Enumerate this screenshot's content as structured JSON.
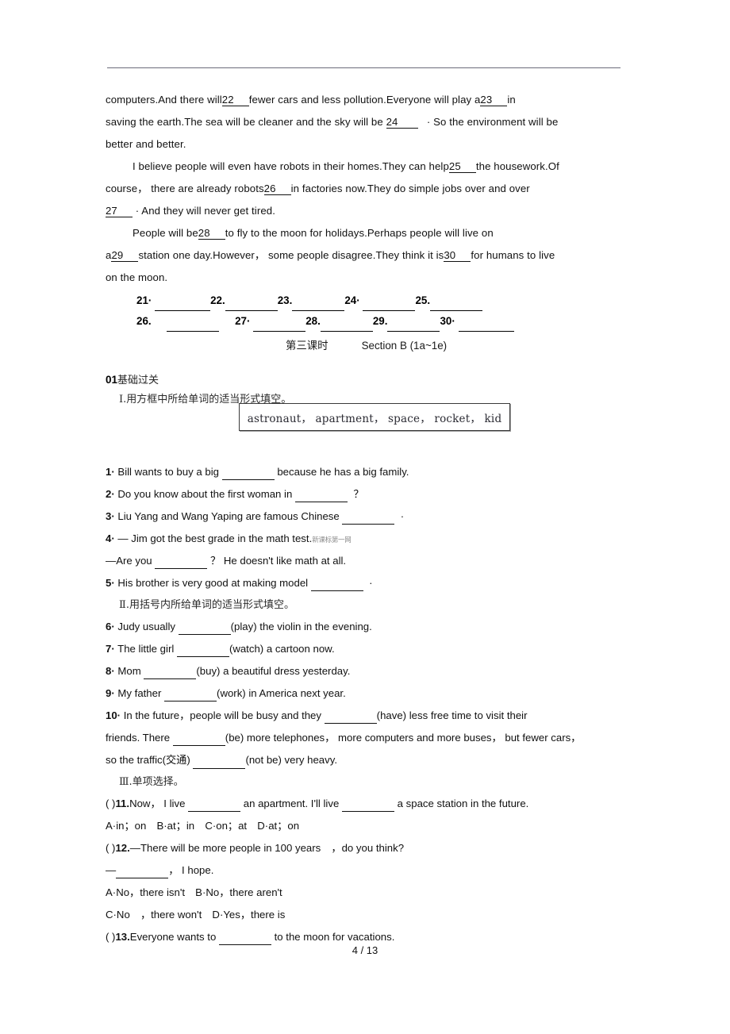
{
  "document": {
    "page_number_label": "4 / 13"
  },
  "passage": {
    "para1": {
      "seg1": "computers.And  there  will",
      "blank22": "22",
      "seg2": "fewer   cars  and  less  pollution.Everyone   will   play   a",
      "blank23": "23",
      "seg3": "in",
      "seg4": "saving the earth.The sea will be cleaner and the sky will be",
      "blank24": "24",
      "seg5": "· So the environment will be",
      "seg6": "better and better."
    },
    "para2": {
      "seg1": "I believe people will even have robots in their homes.They can help",
      "blank25": "25",
      "seg2": "the housework.Of",
      "seg3": "course，  there  are  already  robots",
      "blank26": "26",
      "seg4": "in  factories  now.They  do  simple  jobs  over  and  over",
      "blank27": "27",
      "seg5": "· And they will never get tired."
    },
    "para3": {
      "seg1": "People  will   be",
      "blank28": "28",
      "seg2": "to  fly  to  the  moon  for  holidays.Perhaps  people  will   live  on",
      "seg3": "a",
      "blank29": "29",
      "seg4": "station one day.However， some people disagree.They think it is",
      "blank30": "30",
      "seg5": "for humans to live",
      "seg6": "on the moon."
    }
  },
  "answer_rows": [
    {
      "items": [
        {
          "num": "21·"
        },
        {
          "num": "22."
        },
        {
          "num": "23."
        },
        {
          "num": "24·"
        },
        {
          "num": "25."
        }
      ]
    },
    {
      "items": [
        {
          "num": "26."
        },
        {
          "num": "27·"
        },
        {
          "num": "28."
        },
        {
          "num": "29."
        },
        {
          "num": "30·"
        }
      ]
    }
  ],
  "lesson_title": {
    "period": "第三课时",
    "section": "Section B (1a~1e)"
  },
  "section_01": {
    "number": "01",
    "label": "基础过关"
  },
  "part1": {
    "heading_numeral": "Ⅰ",
    "heading_text": ".用方框中所给单词的适当形式填空。",
    "word_box": "astronaut， apartment， space， rocket， kid",
    "questions": [
      {
        "num": "1·",
        "before": "Bill wants to buy a big",
        "after": "because he has a big family."
      },
      {
        "num": "2·",
        "before": "Do you know about the first woman in",
        "after": "？"
      },
      {
        "num": "3·",
        "before": "Liu Yang and Wang Yaping are famous Chinese",
        "after": "·"
      },
      {
        "num": "4·",
        "before": "— Jim got the best grade in the math test.",
        "watermark": "新课标第一网",
        "line2_before": "—Are you",
        "line2_after": "？ He doesn't like math at all."
      },
      {
        "num": "5·",
        "before": "His brother is very good at making model",
        "after": "·"
      }
    ]
  },
  "part2": {
    "heading_numeral": "Ⅱ",
    "heading_text": ".用括号内所给单词的适当形式填空。",
    "questions": [
      {
        "num": "6·",
        "before": "Judy usually",
        "after": "(play) the violin in the evening."
      },
      {
        "num": "7·",
        "before": "The little girl",
        "after": "(watch) a cartoon now."
      },
      {
        "num": "8·",
        "before": "Mom",
        "after": "(buy) a beautiful dress yesterday."
      },
      {
        "num": "9·",
        "before": "My father",
        "after": "(work) in America next year."
      },
      {
        "num": "10·",
        "before": "In the future，people will be busy and they",
        "mid1": "(have) less free time to visit their",
        "line2_before": "friends. There",
        "mid2": "(be) more telephones， more computers and more buses， but fewer cars，",
        "line3_before": "so the traffic(",
        "line3_cn": "交通",
        "line3_mid": ")",
        "after": "(not be) very heavy."
      }
    ]
  },
  "part3": {
    "heading_numeral": "Ⅲ",
    "heading_text": ".单项选择。",
    "questions": [
      {
        "paren": "(        )",
        "num": "11.",
        "text_before": "Now， I live",
        "text_mid": "an apartment. I'll live",
        "text_after": "a space station in the future.",
        "options": "A·in；on　B·at；in　C·on；at　D·at；on"
      },
      {
        "paren": "(        )",
        "num": "12.",
        "text_before": "—There will be more people in 100 years　，do you think?",
        "line2_before": "—",
        "line2_after": "， I hope.",
        "options_line1": "A·No，there isn't　B·No，there aren't",
        "options_line2": "C·No　，there won't　D·Yes，there is"
      },
      {
        "paren": "(        )",
        "num": "13.",
        "text_before": "Everyone wants to",
        "text_after": "to the moon for vacations."
      }
    ]
  }
}
